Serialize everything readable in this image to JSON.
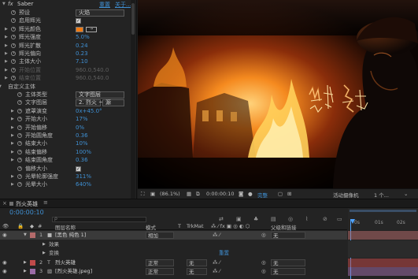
{
  "effect_panel": {
    "fx_badge": "fx",
    "effect_name": "Saber",
    "reset_label": "重置",
    "about_label": "关于...",
    "rows": [
      {
        "label": "预设",
        "value": "火焰",
        "kind": "dropdown",
        "indent": 1
      },
      {
        "label": "启用辉光",
        "value": "",
        "kind": "checkbox",
        "indent": 1
      },
      {
        "label": "辉光颜色",
        "value": "",
        "kind": "color",
        "indent": 1
      },
      {
        "label": "辉光强度",
        "value": "5.0%",
        "kind": "number",
        "indent": 1
      },
      {
        "label": "辉光扩散",
        "value": "0.24",
        "kind": "number",
        "indent": 1
      },
      {
        "label": "辉光偏向",
        "value": "0.23",
        "kind": "number",
        "indent": 1
      },
      {
        "label": "主体大小",
        "value": "7.10",
        "kind": "number",
        "indent": 1
      },
      {
        "label": "开始位置",
        "value": "960.0,540.0",
        "kind": "number",
        "indent": 1,
        "disabled": true
      },
      {
        "label": "结束位置",
        "value": "960.0,540.0",
        "kind": "number",
        "indent": 1,
        "disabled": true
      },
      {
        "label": "自定义主体",
        "value": "",
        "kind": "group",
        "indent": 0
      },
      {
        "label": "主体类型",
        "value": "文字图层",
        "kind": "dropdown",
        "indent": 2
      },
      {
        "label": "文字图层",
        "value": "2. 烈火 ~",
        "kind": "layer-dropdown",
        "indent": 2,
        "value2": "源"
      },
      {
        "label": "遮罩演变",
        "value": "0x+45.0°",
        "kind": "number",
        "indent": 2
      },
      {
        "label": "开始大小",
        "value": "17%",
        "kind": "number",
        "indent": 2
      },
      {
        "label": "开始偏移",
        "value": "0%",
        "kind": "number",
        "indent": 2
      },
      {
        "label": "开始圆角度",
        "value": "0.36",
        "kind": "number",
        "indent": 2
      },
      {
        "label": "结束大小",
        "value": "10%",
        "kind": "number",
        "indent": 2
      },
      {
        "label": "结束偏移",
        "value": "100%",
        "kind": "number",
        "indent": 2
      },
      {
        "label": "结束圆角度",
        "value": "0.36",
        "kind": "number",
        "indent": 2
      },
      {
        "label": "偏移大小",
        "value": "",
        "kind": "checkbox",
        "indent": 2
      },
      {
        "label": "光晕轮廓强度",
        "value": "311%",
        "kind": "number",
        "indent": 2
      },
      {
        "label": "光晕大小",
        "value": "640%",
        "kind": "number",
        "indent": 2
      }
    ]
  },
  "viewer_toolbar": {
    "zoom": "(86.1%)",
    "timecode": "0:00:00:10",
    "resolution": "完整",
    "camera": "活动摄像机",
    "views": "1 个..."
  },
  "timeline": {
    "comp_name": "烈火英雄",
    "menu_icon": "≡",
    "timecode": "0:00:00:10",
    "search_placeholder": "ρ",
    "columns": {
      "layer_name": "图层名称",
      "mode": "模式",
      "t": "T",
      "trkmat": "TrkMat",
      "parent": "父级和链接"
    },
    "ruler": [
      "0s",
      "01s",
      "02s"
    ],
    "layers": [
      {
        "num": "1",
        "type": "solid",
        "name": "[黑色 纯色 1]",
        "mode": "相加",
        "trkmat": "",
        "parent": "无",
        "color": "#b46b6b",
        "selected": true
      },
      {
        "sub": true,
        "name": "效果",
        "reset": ""
      },
      {
        "sub": true,
        "name": "变换",
        "reset": "重置"
      },
      {
        "num": "2",
        "type": "text",
        "name": "烈火英雄",
        "mode": "正常",
        "trkmat": "无",
        "parent": "无",
        "color": "#c04a4a"
      },
      {
        "num": "3",
        "type": "image",
        "name": "[烈火英雄.jpeg]",
        "mode": "正常",
        "trkmat": "无",
        "parent": "无",
        "color": "#9b6ba6"
      }
    ]
  },
  "colors": {
    "accent_blue": "#3f8fd2",
    "glow_color": "#f07a12",
    "playhead": "#4fa3ff"
  }
}
